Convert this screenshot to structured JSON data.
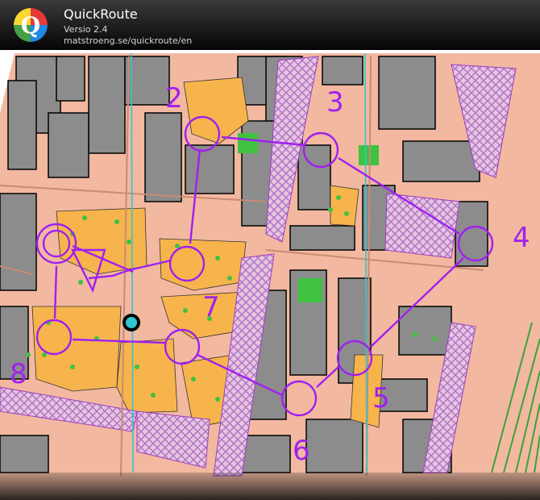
{
  "header": {
    "app_name": "QuickRoute",
    "version": "Versio 2.4",
    "url": "matstroeng.se/quickroute/en",
    "logo_letter": "Q"
  },
  "map": {
    "course_color": "#a020f0",
    "controls": [
      {
        "label": "2"
      },
      {
        "label": "3"
      },
      {
        "label": "4"
      },
      {
        "label": "5"
      },
      {
        "label": "6"
      },
      {
        "label": "7"
      },
      {
        "label": "8"
      }
    ]
  }
}
